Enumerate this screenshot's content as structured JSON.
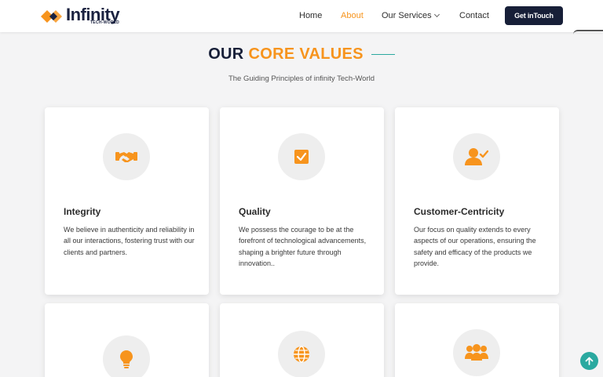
{
  "brand": {
    "name": "Infinity",
    "tagline": "TECH-WORLD"
  },
  "nav": {
    "items": [
      {
        "label": "Home"
      },
      {
        "label": "About"
      },
      {
        "label": "Our Services"
      },
      {
        "label": "Contact"
      }
    ],
    "active": "About",
    "cta_label": "Get inTouch"
  },
  "section": {
    "title_dark": "OUR",
    "title_accent": "CORE VALUES",
    "subtitle": "The Guiding Principles of infinity Tech-World"
  },
  "cards": [
    {
      "title": "Integrity",
      "icon": "handshake-icon",
      "text": "We believe in authenticity and reliability in all our interactions, fostering trust with our clients and partners."
    },
    {
      "title": "Quality",
      "icon": "checkbox-icon",
      "text": "We possess the courage to be at the forefront of technological advancements, shaping a brighter future through innovation.."
    },
    {
      "title": "Customer-Centricity",
      "icon": "user-check-icon",
      "text": "Our focus on quality extends to every aspects of our operations, ensuring the safety and efficacy of the products we provide."
    },
    {
      "title": "",
      "icon": "lightbulb-icon",
      "text": ""
    },
    {
      "title": "",
      "icon": "globe-icon",
      "text": ""
    },
    {
      "title": "",
      "icon": "users-icon",
      "text": ""
    }
  ],
  "colors": {
    "accent": "#f7941d",
    "navy": "#171f38",
    "teal": "#2aa9a0",
    "background": "#f4f4f5"
  }
}
